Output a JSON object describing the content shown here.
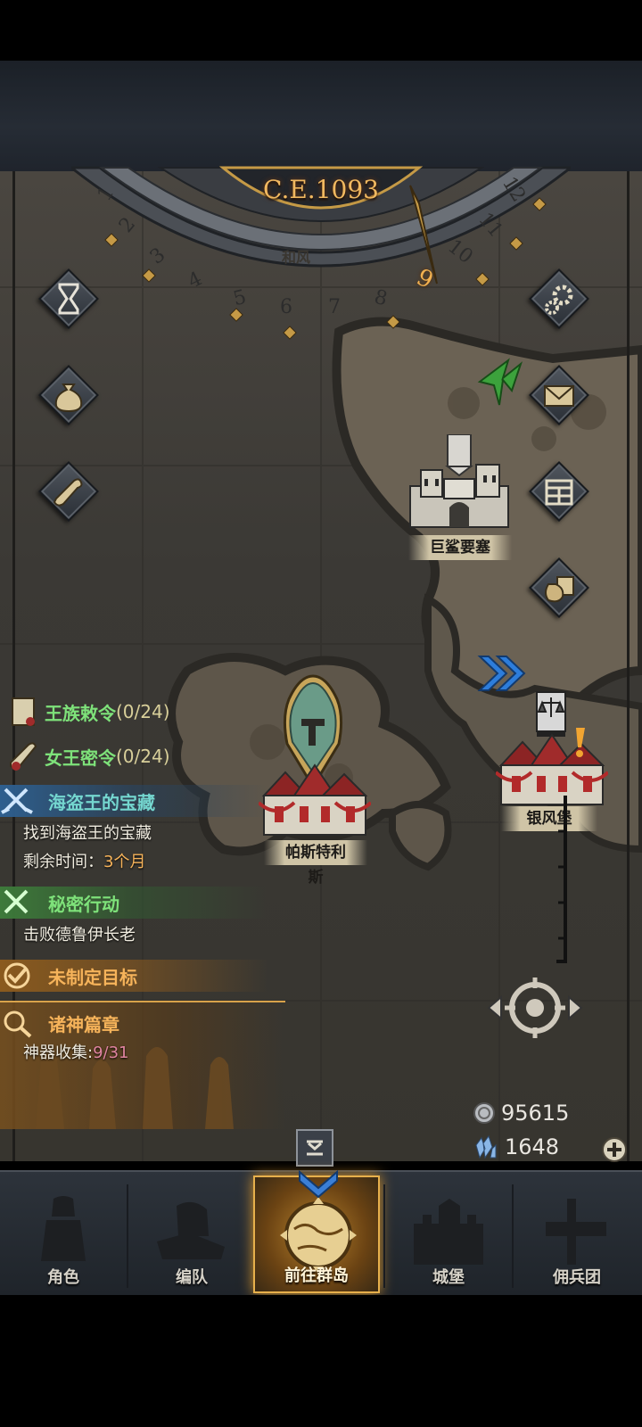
{
  "calendar": {
    "era": "C.E.1093",
    "months": [
      "1",
      "2",
      "3",
      "4",
      "5",
      "6",
      "7",
      "8",
      "9",
      "10",
      "11",
      "12"
    ],
    "current_month": "9",
    "region_label": "和风"
  },
  "locations": {
    "fortress": "巨鲨要塞",
    "capital": "帕斯特利斯",
    "silverwind": "银风堡"
  },
  "quests": {
    "royal_decree": {
      "label": "王族敕令",
      "progress": "(0/24)"
    },
    "queen_order": {
      "label": "女王密令",
      "progress": "(0/24)"
    },
    "pirate": {
      "title": "海盗王的宝藏",
      "desc": "找到海盗王的宝藏",
      "time_prefix": "剩余时间：",
      "time_value": "3个月"
    },
    "secret": {
      "title": "秘密行动",
      "desc": "击败德鲁伊长老"
    },
    "goal": {
      "title": "未制定目标"
    },
    "gods": {
      "title": "诸神篇章",
      "prefix": "神器收集:",
      "value": "9/31"
    }
  },
  "currency": {
    "silver": "95615",
    "crystal": "1648"
  },
  "nav": {
    "items": [
      {
        "label": "角色"
      },
      {
        "label": "编队"
      },
      {
        "label": "前往群岛"
      },
      {
        "label": "城堡"
      },
      {
        "label": "佣兵团"
      }
    ]
  },
  "colors": {
    "accent_gold": "#f2b150",
    "quest_green": "#7ee27a",
    "quest_teal": "#74d6cf",
    "quest_orange": "#f6b35a"
  },
  "icons": [
    "hourglass-icon",
    "money-bag-icon",
    "scroll-icon",
    "gear-icon",
    "mail-icon",
    "grid-icon",
    "supplies-icon",
    "locate-icon",
    "expand-icon",
    "plus-icon"
  ]
}
